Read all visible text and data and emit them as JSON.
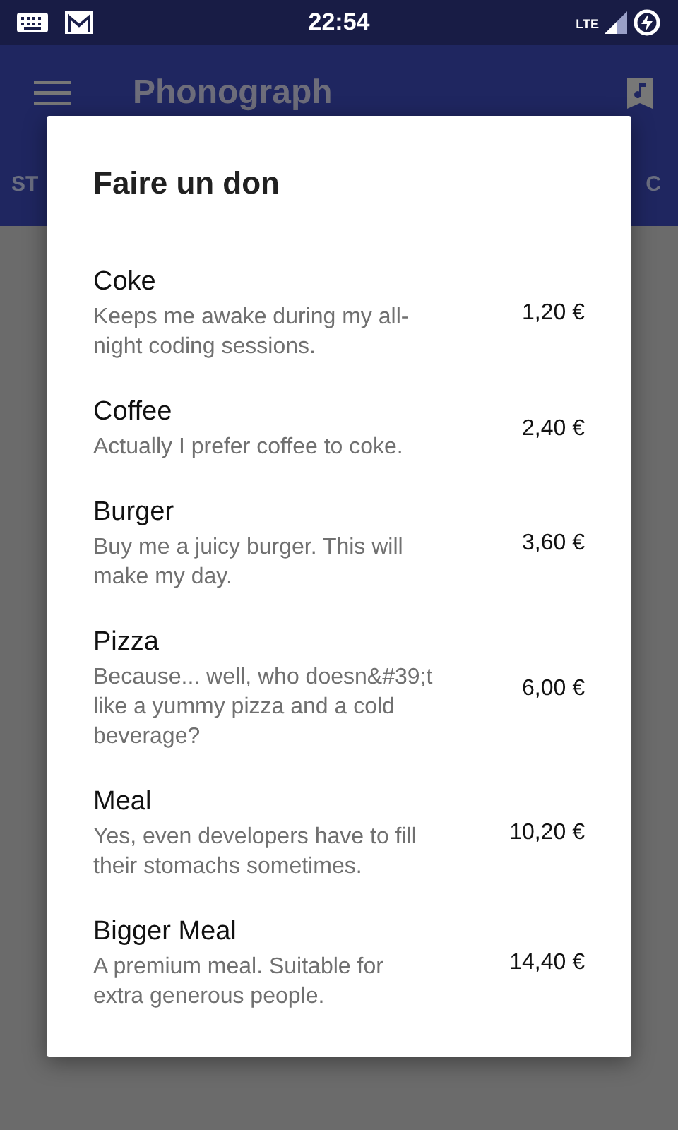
{
  "status_bar": {
    "time": "22:54",
    "network": "LTE"
  },
  "toolbar": {
    "title": "Phonograph"
  },
  "tabs": [
    {
      "label": "ST"
    },
    {
      "label": "C"
    }
  ],
  "dialog": {
    "title": "Faire un don",
    "items": [
      {
        "name": "Coke",
        "description": "Keeps me awake during my all-night coding sessions.",
        "price": "1,20 €"
      },
      {
        "name": "Coffee",
        "description": "Actually I prefer coffee to coke.",
        "price": "2,40 €"
      },
      {
        "name": "Burger",
        "description": "Buy me a juicy burger. This will make my day.",
        "price": "3,60 €"
      },
      {
        "name": "Pizza",
        "description": "Because... well, who doesn&#39;t like a yummy pizza and a cold beverage?",
        "price": "6,00 €"
      },
      {
        "name": "Meal",
        "description": "Yes, even developers have to fill their stomachs sometimes.",
        "price": "10,20 €"
      },
      {
        "name": "Bigger Meal",
        "description": "A premium meal. Suitable for extra generous people.",
        "price": "14,40 €"
      }
    ]
  }
}
